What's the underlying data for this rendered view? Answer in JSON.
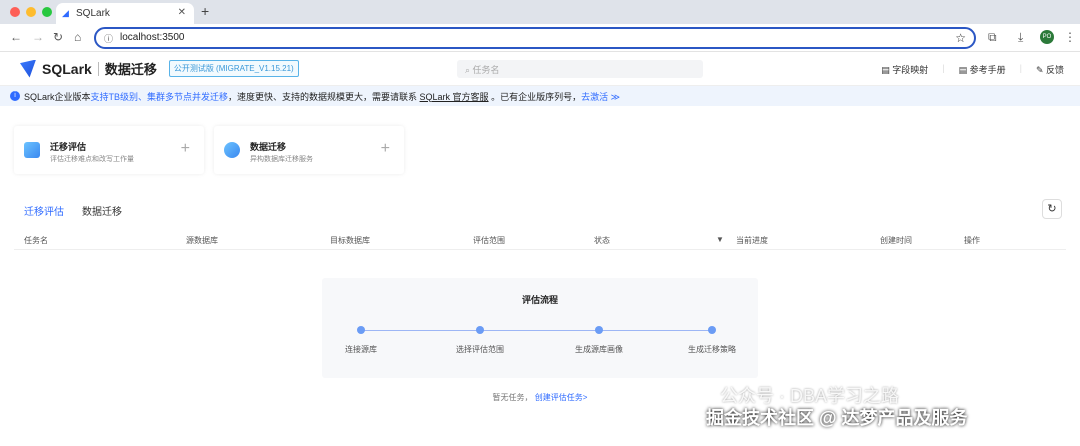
{
  "browser": {
    "tab_title": "SQLark",
    "url": "localhost:3500",
    "profile": "PO"
  },
  "header": {
    "brand": "SQLark",
    "product": "数据迁移",
    "version": "公开测试版 (MIGRATE_V1.15.21)",
    "search_placeholder": "任务名",
    "links": [
      "字段映射",
      "参考手册",
      "反馈"
    ]
  },
  "banner": {
    "p1": "SQLark企业版本",
    "p2": "支持TB级别、集群多节点并发迁移",
    "p3": "，速度更快、支持的数据规模更大，需要请联系 ",
    "p4": "SQLark 官方客服",
    "p5": " 。已有企业版序列号，",
    "p6": "去激活 ≫"
  },
  "cards": [
    {
      "title": "迁移评估",
      "desc": "评估迁移难点和改写工作量"
    },
    {
      "title": "数据迁移",
      "desc": "异构数据库迁移服务"
    }
  ],
  "tabs": [
    "迁移评估",
    "数据迁移"
  ],
  "columns": [
    "任务名",
    "源数据库",
    "目标数据库",
    "评估范围",
    "状态",
    "当前进度",
    "创建时间",
    "操作"
  ],
  "flow": {
    "title": "评估流程",
    "steps": [
      "连接源库",
      "选择评估范围",
      "生成源库画像",
      "生成迁移策略"
    ]
  },
  "empty": {
    "text": "暂无任务，",
    "link": "创建评估任务>"
  },
  "watermark": {
    "line1": "公众号 · DBA学习之路",
    "line2": "掘金技术社区 @ 达梦产品及服务"
  }
}
